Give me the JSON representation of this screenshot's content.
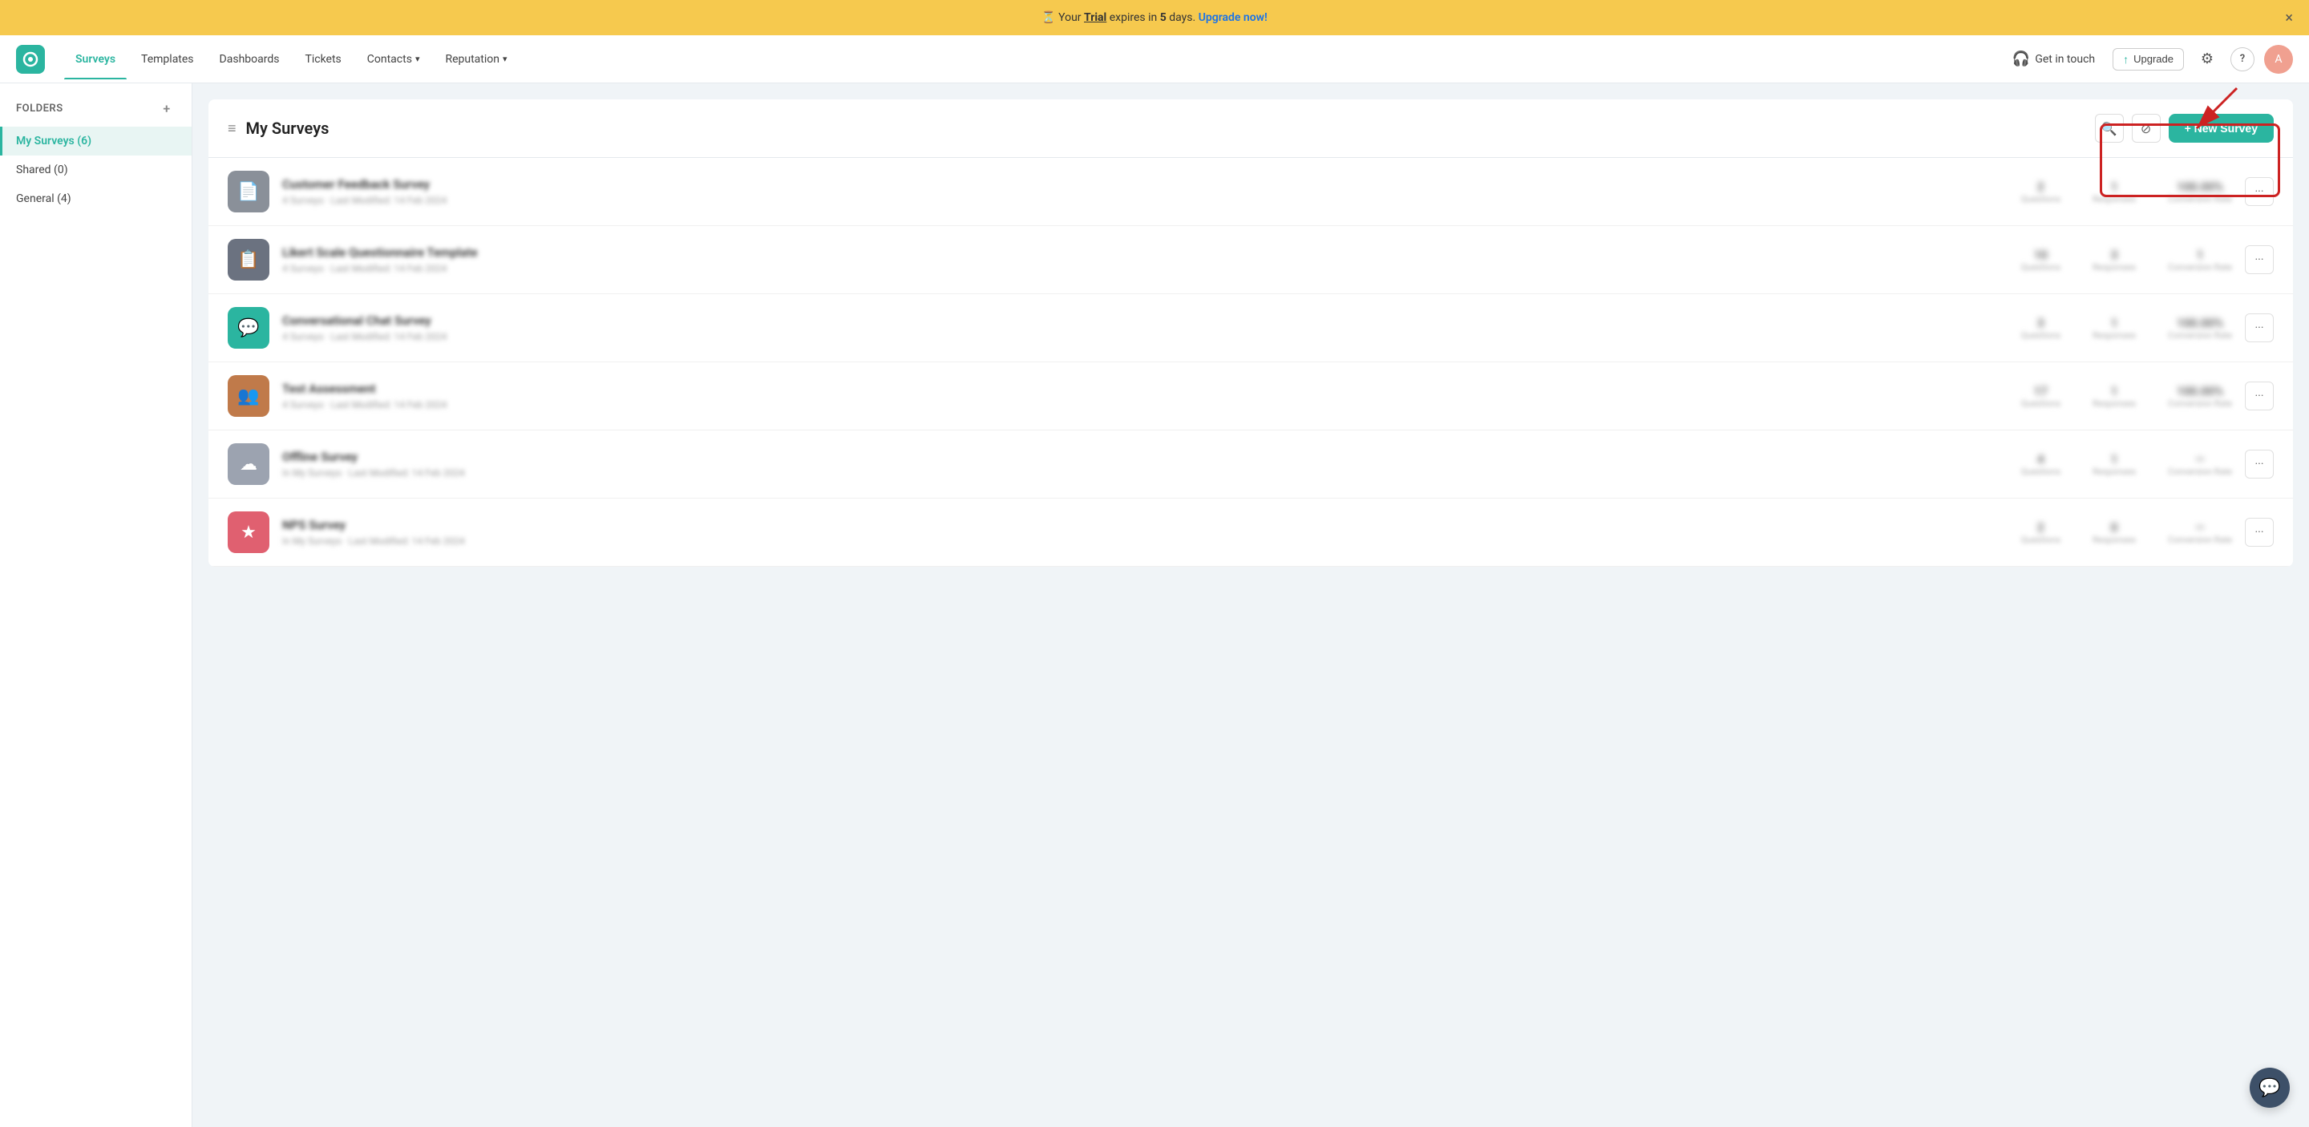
{
  "banner": {
    "text_prefix": "Your ",
    "trial_word": "Trial",
    "text_middle": " expires in ",
    "days": "5",
    "text_suffix": " days. ",
    "upgrade_link": "Upgrade now!",
    "close_label": "×"
  },
  "navbar": {
    "logo_alt": "SurveySparrow logo",
    "nav_items": [
      {
        "id": "surveys",
        "label": "Surveys",
        "active": true,
        "has_dropdown": false
      },
      {
        "id": "templates",
        "label": "Templates",
        "active": false,
        "has_dropdown": false
      },
      {
        "id": "dashboards",
        "label": "Dashboards",
        "active": false,
        "has_dropdown": false
      },
      {
        "id": "tickets",
        "label": "Tickets",
        "active": false,
        "has_dropdown": false
      },
      {
        "id": "contacts",
        "label": "Contacts",
        "active": false,
        "has_dropdown": true
      },
      {
        "id": "reputation",
        "label": "Reputation",
        "active": false,
        "has_dropdown": true
      }
    ],
    "get_in_touch_label": "Get in touch",
    "upgrade_label": "Upgrade",
    "settings_icon": "⚙",
    "help_icon": "?"
  },
  "sidebar": {
    "folders_label": "Folders",
    "add_icon": "+",
    "items": [
      {
        "id": "my-surveys",
        "label": "My Surveys (6)",
        "active": true
      },
      {
        "id": "shared",
        "label": "Shared (0)",
        "active": false
      },
      {
        "id": "general",
        "label": "General (4)",
        "active": false
      }
    ]
  },
  "survey_list": {
    "title": "My Surveys",
    "list_icon": "≡",
    "search_icon": "🔍",
    "filter_icon": "⊘",
    "new_survey_label": "+ New Survey",
    "surveys": [
      {
        "id": 1,
        "name": "Customer Feedback Survey",
        "meta": "4 Surveys · Last Modified: 14 Feb 2024",
        "icon_type": "gray",
        "icon_symbol": "📄",
        "stat1_value": "2",
        "stat1_label": "Questions",
        "stat2_value": "1",
        "stat2_label": "Responses",
        "stat3_value": "100.00%",
        "stat3_label": "Conversion Rate"
      },
      {
        "id": 2,
        "name": "Likert Scale Questionnaire Template",
        "meta": "4 Surveys · Last Modified: 14 Feb 2024",
        "icon_type": "dark-gray",
        "icon_symbol": "📋",
        "stat1_value": "10",
        "stat1_label": "Questions",
        "stat2_value": "3",
        "stat2_label": "Responses",
        "stat3_value": "1",
        "stat3_label": "Conversion Rate"
      },
      {
        "id": 3,
        "name": "Conversational Chat Survey",
        "meta": "4 Surveys · Last Modified: 14 Feb 2024",
        "icon_type": "teal",
        "icon_symbol": "💬",
        "stat1_value": "3",
        "stat1_label": "Questions",
        "stat2_value": "1",
        "stat2_label": "Responses",
        "stat3_value": "100.00%",
        "stat3_label": "Conversion Rate"
      },
      {
        "id": 4,
        "name": "Test Assessment",
        "meta": "4 Surveys · Last Modified: 14 Feb 2024",
        "icon_type": "brown",
        "icon_symbol": "👥",
        "stat1_value": "17",
        "stat1_label": "Questions",
        "stat2_value": "1",
        "stat2_label": "Responses",
        "stat3_value": "100.00%",
        "stat3_label": "Conversion Rate"
      },
      {
        "id": 5,
        "name": "Offline Survey",
        "meta": "In My Surveys · Last Modified: 14 Feb 2024",
        "icon_type": "light-gray",
        "icon_symbol": "☁",
        "stat1_value": "4",
        "stat1_label": "Questions",
        "stat2_value": "1",
        "stat2_label": "Responses",
        "stat3_value": "—",
        "stat3_label": "Conversion Rate"
      },
      {
        "id": 6,
        "name": "NPS Survey",
        "meta": "In My Surveys · Last Modified: 14 Feb 2024",
        "icon_type": "pink",
        "icon_symbol": "★",
        "stat1_value": "2",
        "stat1_label": "Questions",
        "stat2_value": "0",
        "stat2_label": "Responses",
        "stat3_value": "—",
        "stat3_label": "Conversion Rate"
      }
    ]
  },
  "chat_bubble_icon": "💬"
}
